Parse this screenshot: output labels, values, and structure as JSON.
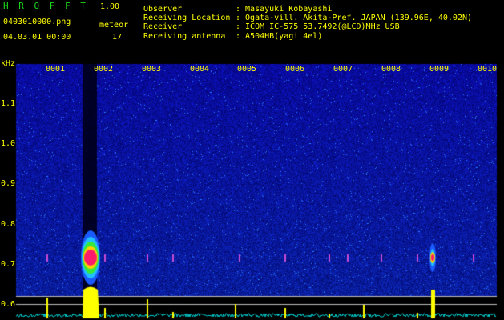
{
  "header": {
    "app_title": "H R O F F T",
    "app_version": "1.00",
    "filename": "0403010000.png",
    "datetime": "04.03.01 00:00",
    "meteor_label": "meteor",
    "meteor_count": "17",
    "info_rows": [
      {
        "key": "Observer",
        "value": ": Masayuki Kobayashi"
      },
      {
        "key": "Receiving Location",
        "value": ": Ogata-vill. Akita-Pref. JAPAN (139.96E, 40.02N)"
      },
      {
        "key": "Receiver",
        "value": ": ICOM IC-575 53.7492(@LCD)MHz USB"
      },
      {
        "key": "Receiving antenna",
        "value": ": A504HB(yagi 4el)"
      }
    ]
  },
  "plot": {
    "y_unit": "kHz",
    "y_ticks": [
      "1.1",
      "1.0",
      "0.9",
      "0.8",
      "0.7",
      "0.6"
    ],
    "x_ticks": [
      "0001",
      "0002",
      "0003",
      "0004",
      "0005",
      "0006",
      "0007",
      "0008",
      "0009",
      "0010"
    ],
    "colors": {
      "background": "#000000",
      "noise_dark": "#0a0a5e",
      "noise_light": "#2a3bd8",
      "axis_text": "#ffff00",
      "title_green": "#19d919",
      "baseline_cyan": "#00d0d0",
      "meteor_core": "#ff1a6b",
      "meteor_ring": "#38e838",
      "bar_yellow": "#ffff00"
    },
    "meteor_events": [
      {
        "minute": 2,
        "label": "0002",
        "strength": "strong"
      },
      {
        "minute": 9,
        "label": "0009",
        "strength": "medium"
      }
    ]
  }
}
